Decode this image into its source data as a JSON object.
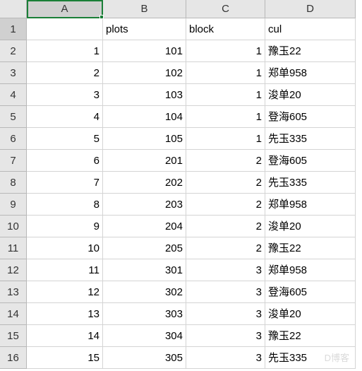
{
  "columns": [
    "A",
    "B",
    "C",
    "D"
  ],
  "headerRow": {
    "A": "",
    "B": "plots",
    "C": "block",
    "D": "cul"
  },
  "rows": [
    {
      "n": 1,
      "A": 1,
      "B": 101,
      "C": 1,
      "D": "豫玉22"
    },
    {
      "n": 2,
      "A": 2,
      "B": 102,
      "C": 1,
      "D": "郑单958"
    },
    {
      "n": 3,
      "A": 3,
      "B": 103,
      "C": 1,
      "D": "浚单20"
    },
    {
      "n": 4,
      "A": 4,
      "B": 104,
      "C": 1,
      "D": "登海605"
    },
    {
      "n": 5,
      "A": 5,
      "B": 105,
      "C": 1,
      "D": "先玉335"
    },
    {
      "n": 6,
      "A": 6,
      "B": 201,
      "C": 2,
      "D": "登海605"
    },
    {
      "n": 7,
      "A": 7,
      "B": 202,
      "C": 2,
      "D": "先玉335"
    },
    {
      "n": 8,
      "A": 8,
      "B": 203,
      "C": 2,
      "D": "郑单958"
    },
    {
      "n": 9,
      "A": 9,
      "B": 204,
      "C": 2,
      "D": "浚单20"
    },
    {
      "n": 10,
      "A": 10,
      "B": 205,
      "C": 2,
      "D": "豫玉22"
    },
    {
      "n": 11,
      "A": 11,
      "B": 301,
      "C": 3,
      "D": "郑单958"
    },
    {
      "n": 12,
      "A": 12,
      "B": 302,
      "C": 3,
      "D": "登海605"
    },
    {
      "n": 13,
      "A": 13,
      "B": 303,
      "C": 3,
      "D": "浚单20"
    },
    {
      "n": 14,
      "A": 14,
      "B": 304,
      "C": 3,
      "D": "豫玉22"
    },
    {
      "n": 15,
      "A": 15,
      "B": 305,
      "C": 3,
      "D": "先玉335"
    }
  ],
  "selection": {
    "cell": "A1"
  },
  "watermark": "D博客"
}
